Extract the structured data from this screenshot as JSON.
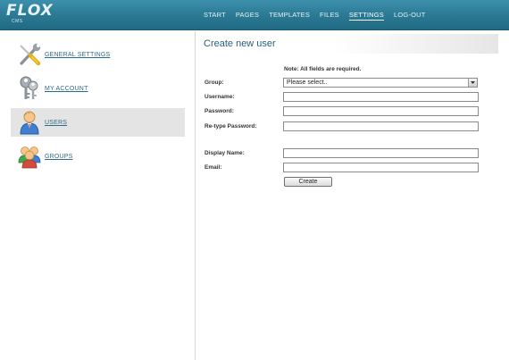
{
  "app": {
    "logo": "FLOX",
    "logo_sub": "CMS"
  },
  "nav": {
    "items": [
      "START",
      "PAGES",
      "TEMPLATES",
      "FILES",
      "SETTINGS",
      "LOG-OUT"
    ],
    "active": "SETTINGS"
  },
  "sidebar": {
    "items": [
      {
        "label": "GENERAL SETTINGS",
        "icon": "tools-icon"
      },
      {
        "label": "MY ACCOUNT",
        "icon": "keys-icon"
      },
      {
        "label": "USERS",
        "icon": "user-icon"
      },
      {
        "label": "GROUPS",
        "icon": "group-icon"
      }
    ],
    "active": "USERS"
  },
  "main": {
    "title": "Create new user",
    "note": "Note: All fields are required.",
    "form": {
      "group_label": "Group:",
      "group_value": "Please select..",
      "username_label": "Username:",
      "password_label": "Password:",
      "retype_label": "Re-type Password:",
      "display_label": "Display Name:",
      "email_label": "Email:",
      "submit": "Create"
    }
  },
  "colors": {
    "topbar": "#2a7893",
    "link": "#2d6c8a",
    "title": "#2b5f78",
    "active_item_bg": "#e4e4e4"
  }
}
